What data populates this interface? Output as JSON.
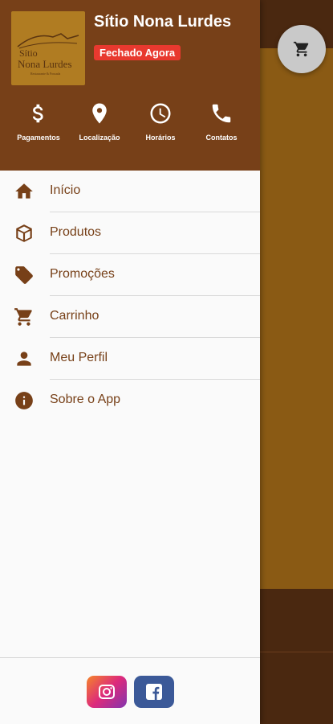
{
  "store": {
    "name": "Sítio Nona Lurdes",
    "status": "Fechado Agora",
    "logo_line1": "Sítio",
    "logo_line2": "Nona Lurdes",
    "logo_line3": "Restaurante & Pousada"
  },
  "quick_actions": [
    {
      "label": "Pagamentos",
      "icon": "dollar-icon"
    },
    {
      "label": "Localização",
      "icon": "location-pin-icon"
    },
    {
      "label": "Horários",
      "icon": "clock-icon"
    },
    {
      "label": "Contatos",
      "icon": "phone-icon"
    }
  ],
  "menu": [
    {
      "label": "Início",
      "icon": "home-icon"
    },
    {
      "label": "Produtos",
      "icon": "box-icon"
    },
    {
      "label": "Promoções",
      "icon": "tag-icon"
    },
    {
      "label": "Carrinho",
      "icon": "cart-icon"
    },
    {
      "label": "Meu Perfil",
      "icon": "person-icon"
    },
    {
      "label": "Sobre o App",
      "icon": "info-icon"
    }
  ],
  "social": [
    {
      "name": "instagram",
      "icon": "instagram-icon"
    },
    {
      "name": "facebook",
      "icon": "facebook-icon"
    }
  ],
  "colors": {
    "header": "#774018",
    "accent_text": "#774018",
    "status_badge": "#e8392f",
    "background_app": "#8a5a14"
  }
}
